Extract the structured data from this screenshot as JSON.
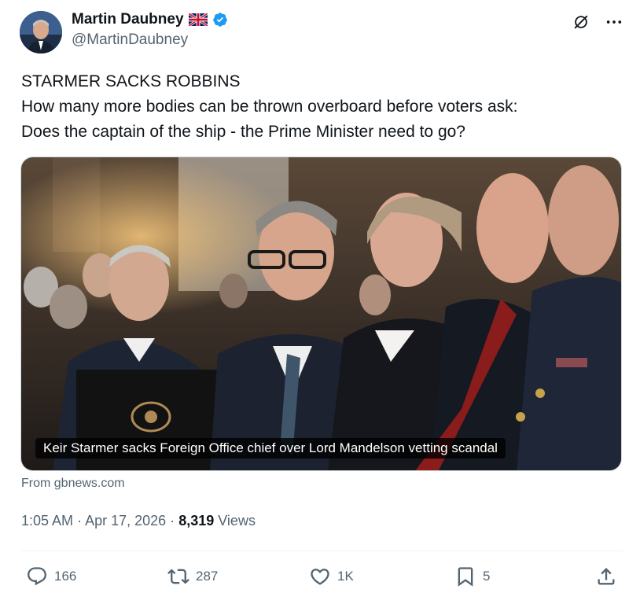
{
  "author": {
    "display_name": "Martin Daubney",
    "handle": "@MartinDaubney",
    "flag": "uk-flag-icon",
    "verified": "verified-badge-icon"
  },
  "tweet": {
    "lines": [
      "STARMER SACKS ROBBINS",
      "How many more bodies can be thrown overboard before voters ask:",
      "Does the captain of the ship - the Prime Minister need to go?"
    ]
  },
  "media": {
    "caption": "Keir Starmer sacks Foreign Office chief over Lord Mandelson vetting scandal"
  },
  "source": "From gbnews.com",
  "meta": {
    "time": "1:05 AM",
    "separator": "·",
    "date": "Apr 17, 2026",
    "views_count": "8,319",
    "views_label": "Views"
  },
  "actions": {
    "replies": "166",
    "reposts": "287",
    "likes": "1K",
    "bookmarks": "5"
  },
  "colors": {
    "text": "#0f1419",
    "secondary": "#536471",
    "verified": "#1d9bf0",
    "divider": "#eff3f4"
  }
}
